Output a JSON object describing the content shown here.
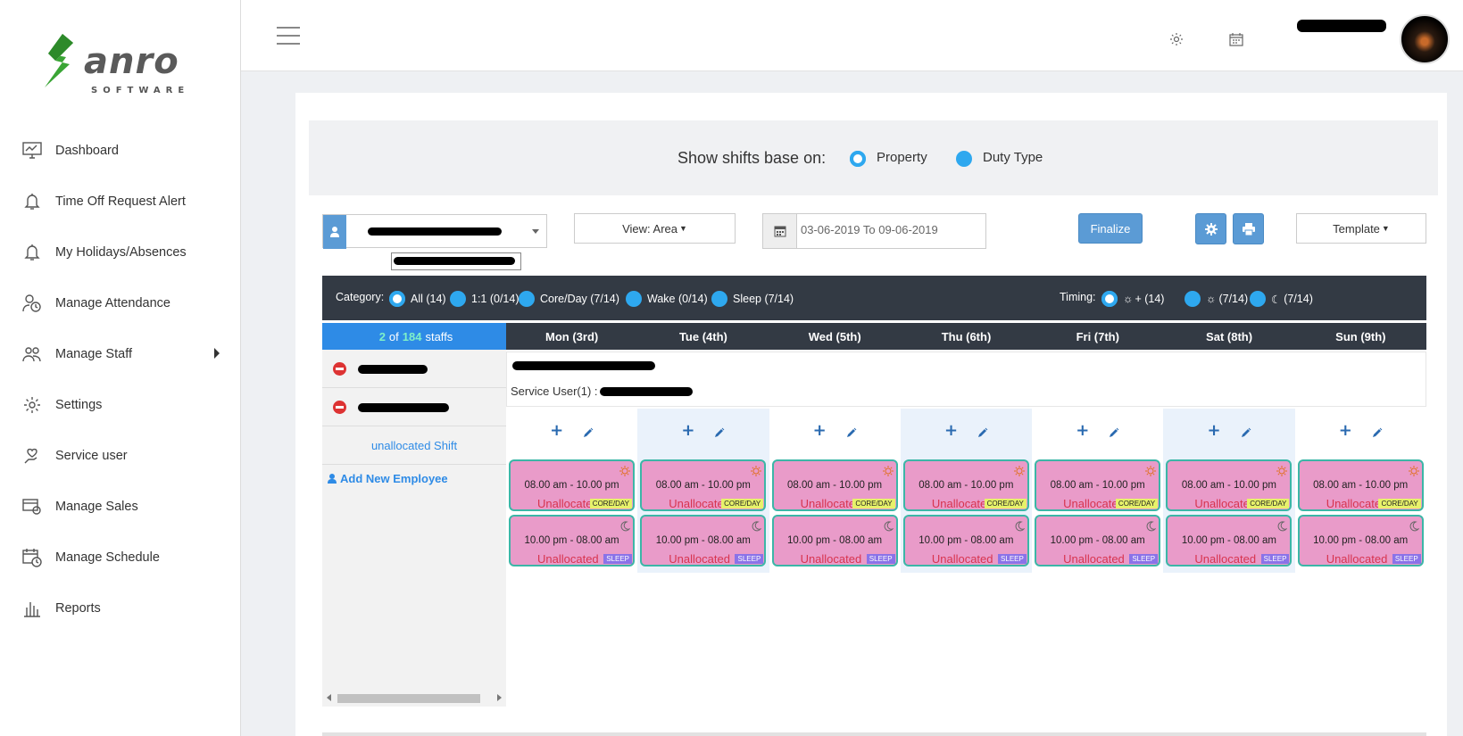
{
  "brand": {
    "name": "anro",
    "sub": "SOFTWARE",
    "accent": "#3aa535"
  },
  "sidebar": {
    "items": [
      {
        "label": "Dashboard",
        "icon": "monitor-icon"
      },
      {
        "label": "Time Off Request Alert",
        "icon": "bell-icon"
      },
      {
        "label": "My Holidays/Absences",
        "icon": "bell-icon"
      },
      {
        "label": "Manage Attendance",
        "icon": "user-clock-icon"
      },
      {
        "label": "Manage Staff",
        "icon": "users-icon"
      },
      {
        "label": "Settings",
        "icon": "gear-icon"
      },
      {
        "label": "Service user",
        "icon": "hand-heart-icon"
      },
      {
        "label": "Manage Sales",
        "icon": "sales-icon"
      },
      {
        "label": "Manage Schedule",
        "icon": "calendar-clock-icon"
      },
      {
        "label": "Reports",
        "icon": "bar-chart-icon"
      }
    ]
  },
  "showbar": {
    "label": "Show shifts base on:",
    "option1": "Property",
    "option2": "Duty Type"
  },
  "controls": {
    "view_label": "View: Area",
    "date_range": "03-06-2019 To 09-06-2019",
    "finalize_label": "Finalize",
    "template_label": "Template"
  },
  "category": {
    "label": "Category:",
    "items": [
      "All (14)",
      "1:1 (0/14)",
      "Core/Day (7/14)",
      "Wake (0/14)",
      "Sleep (7/14)"
    ],
    "timing_label": "Timing:",
    "timing_items": [
      "+ (14)",
      "(7/14)",
      "(7/14)"
    ]
  },
  "staff": {
    "shown": "2",
    "of": "of",
    "total": "184",
    "unit": "staffs",
    "unallocated_label": "unallocated Shift",
    "add_label": "Add New Employee"
  },
  "property": {
    "service_user_label": "Service User(1) :"
  },
  "days": [
    "Mon (3rd)",
    "Tue (4th)",
    "Wed (5th)",
    "Thu (6th)",
    "Fri (7th)",
    "Sat (8th)",
    "Sun (9th)"
  ],
  "shifts": {
    "day": {
      "time": "08.00 am - 10.00 pm",
      "status": "Unallocated",
      "tag": "CORE/DAY",
      "color": "#e99bc9",
      "tag_color": "#e7f26a"
    },
    "night": {
      "time": "10.00 pm - 08.00 am",
      "status": "Unallocated",
      "tag": "SLEEP",
      "color": "#e99bc9",
      "tag_color": "#8a73e8"
    }
  },
  "colors": {
    "primary": "#5b9bd5",
    "dark_bar": "#333a44",
    "radio": "#2ea8ef"
  }
}
